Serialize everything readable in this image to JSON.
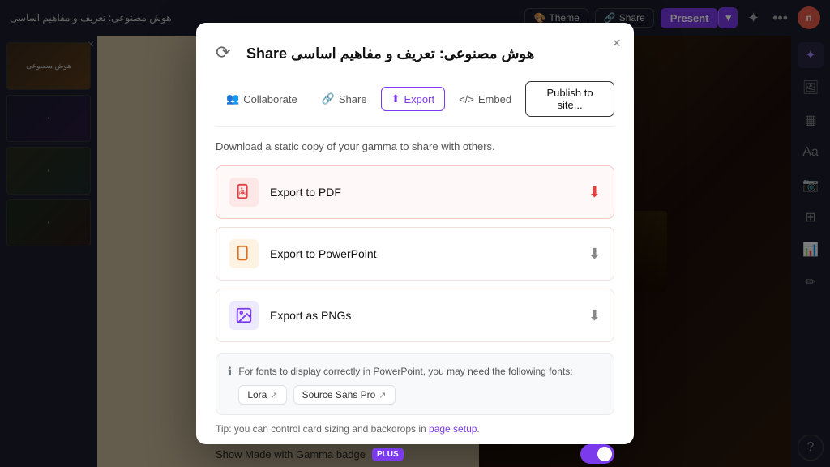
{
  "app": {
    "title": "هوش مصنوعی: تعریف و مفاهیم اساسی"
  },
  "topbar": {
    "theme_label": "Theme",
    "share_label": "Share",
    "present_label": "Present",
    "more_icon": "•••",
    "avatar_initials": "n"
  },
  "modal": {
    "logo_char": "⟳",
    "title": "هوش مصنوعی: تعریف و مفاهیم اساسی Share",
    "close_label": "×",
    "tabs": [
      {
        "id": "collaborate",
        "icon": "👥",
        "label": "Collaborate"
      },
      {
        "id": "share",
        "icon": "🔗",
        "label": "Share"
      },
      {
        "id": "export",
        "icon": "⬆",
        "label": "Export",
        "active": true
      },
      {
        "id": "embed",
        "icon": "</>",
        "label": "Embed"
      }
    ],
    "publish_btn": "Publish to site...",
    "description": "Download a static copy of your gamma to share with others.",
    "export_options": [
      {
        "id": "pdf",
        "icon": "PDF",
        "label": "Export to PDF",
        "type": "pdf"
      },
      {
        "id": "ppt",
        "icon": "PPT",
        "label": "Export to PowerPoint",
        "type": "ppt"
      },
      {
        "id": "png",
        "icon": "🖼",
        "label": "Export as PNGs",
        "type": "png"
      }
    ],
    "fonts_notice": "For fonts to display correctly in PowerPoint, you may need the following fonts:",
    "fonts": [
      {
        "name": "Lora",
        "ext": "↗"
      },
      {
        "name": "Source Sans Pro",
        "ext": "↗"
      }
    ],
    "tip_prefix": "Tip: you can control card sizing and backdrops in ",
    "tip_link_text": "page setup",
    "tip_suffix": ".",
    "badge_label": "Show Made with Gamma badge",
    "plus_label": "PLUS"
  }
}
